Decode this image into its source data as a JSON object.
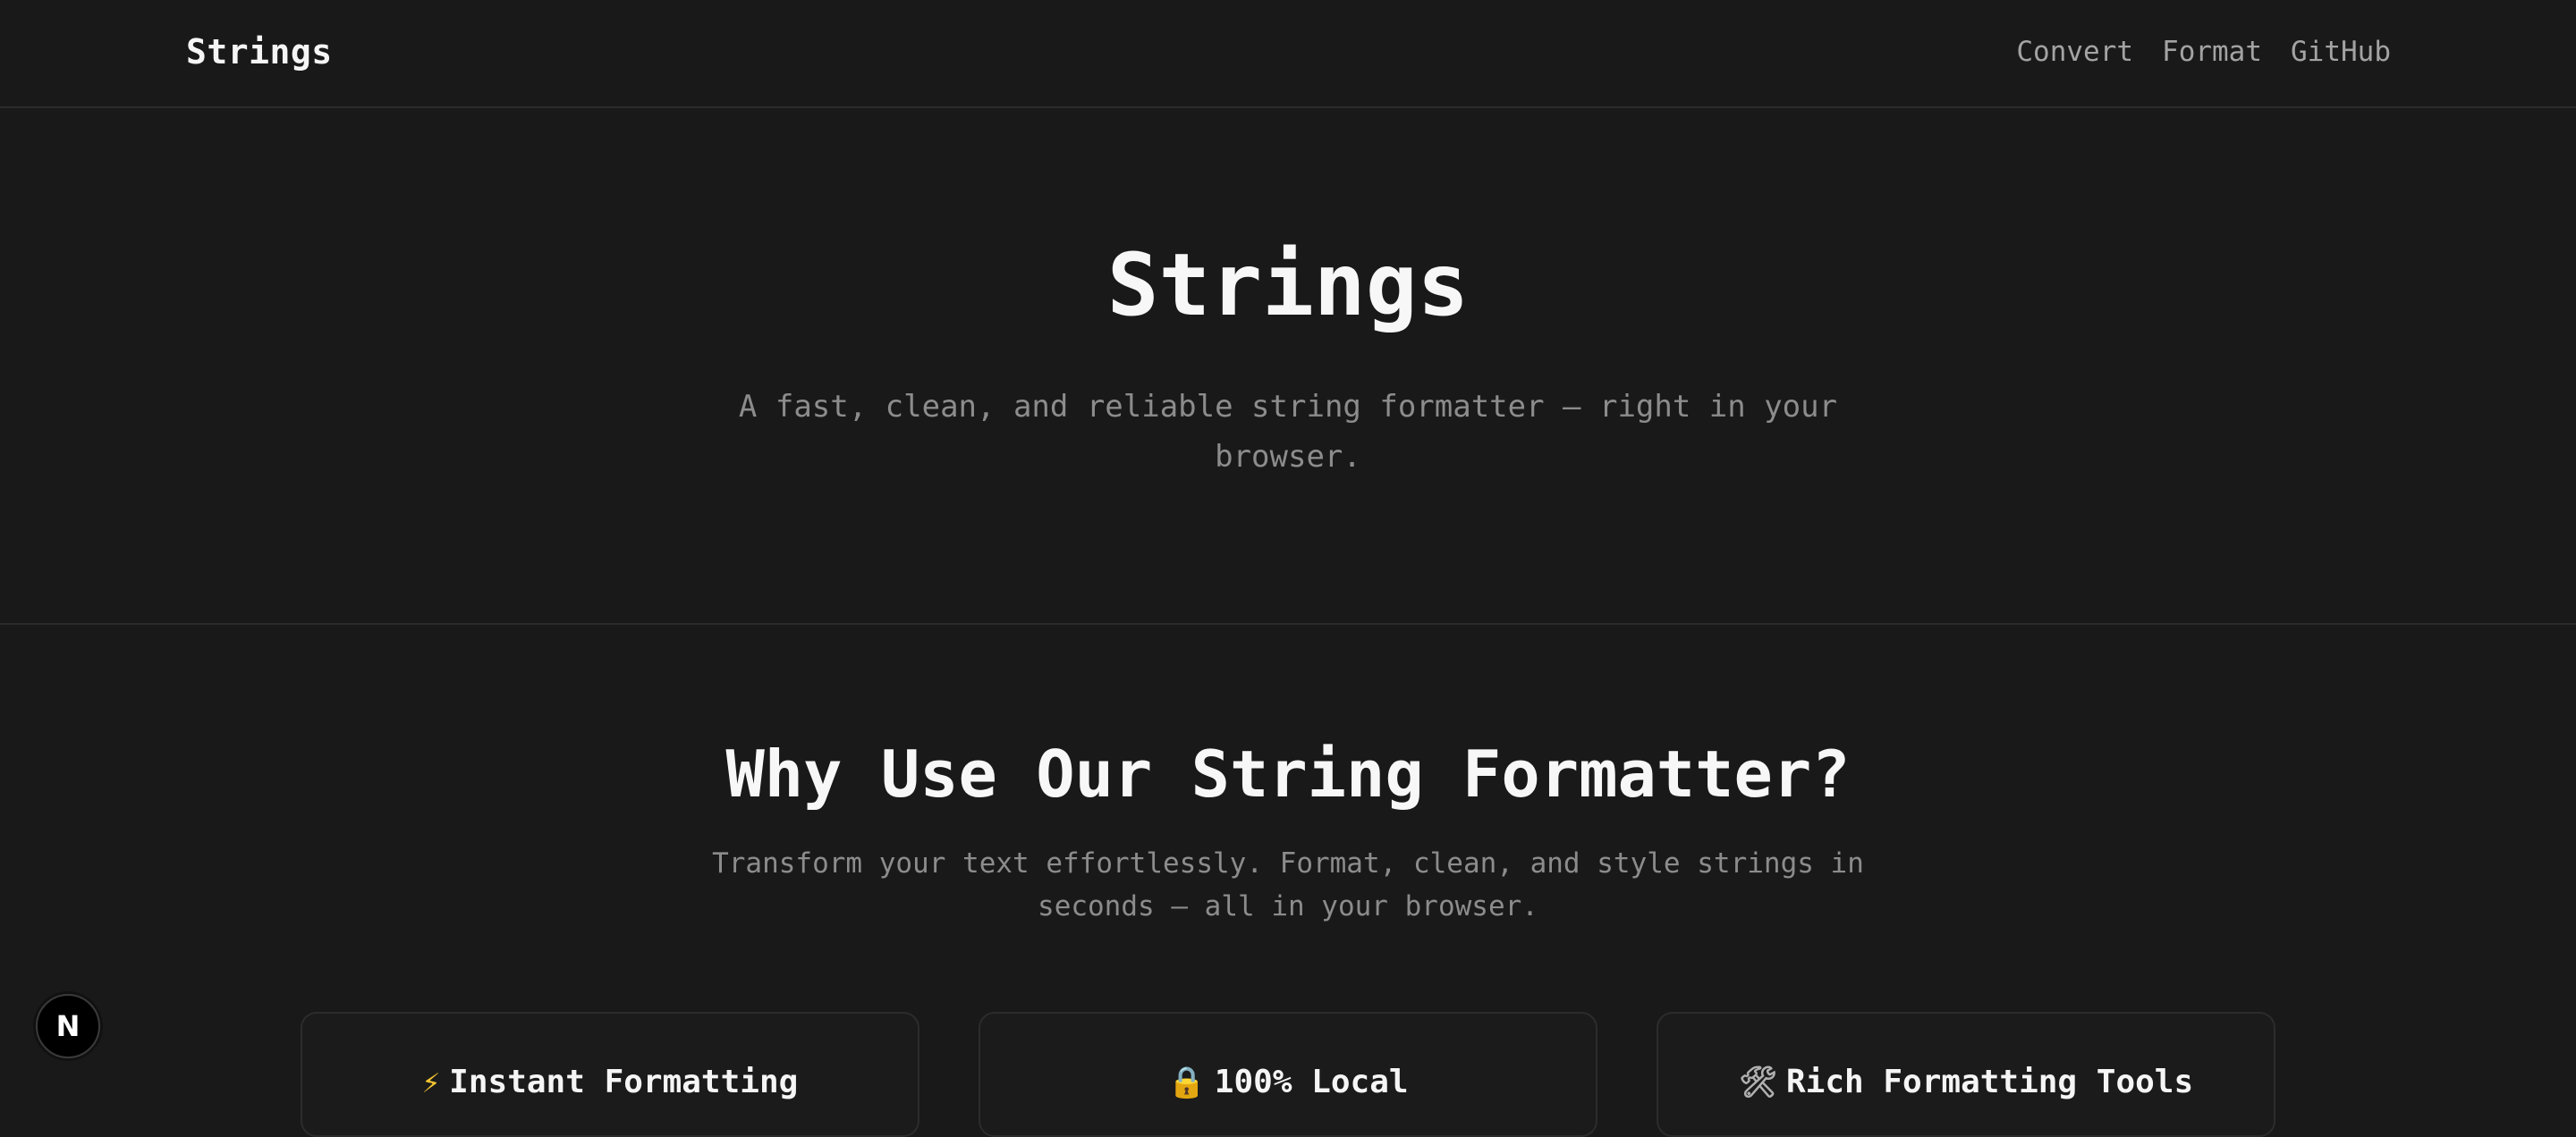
{
  "navbar": {
    "brand": "Strings",
    "links": [
      {
        "label": "Convert"
      },
      {
        "label": "Format"
      },
      {
        "label": "GitHub"
      }
    ]
  },
  "hero": {
    "title": "Strings",
    "subtitle": "A fast, clean, and reliable string formatter — right in your browser."
  },
  "features": {
    "title": "Why Use Our String Formatter?",
    "subtitle": "Transform your text effortlessly. Format, clean, and style strings in seconds — all in your browser.",
    "cards": [
      {
        "icon": "⚡",
        "icon_name": "lightning-icon",
        "title": "Instant Formatting"
      },
      {
        "icon": "🔒",
        "icon_name": "lock-icon",
        "title": "100% Local"
      },
      {
        "icon": "🛠",
        "icon_name": "tools-icon",
        "title": "Rich Formatting Tools"
      }
    ]
  },
  "fab": {
    "letter": "N",
    "icon_name": "nextjs-logo-icon"
  },
  "colors": {
    "background": "#191919",
    "text": "#f5f5f5",
    "muted": "#8c8c8c",
    "border": "#2b2b2b"
  }
}
